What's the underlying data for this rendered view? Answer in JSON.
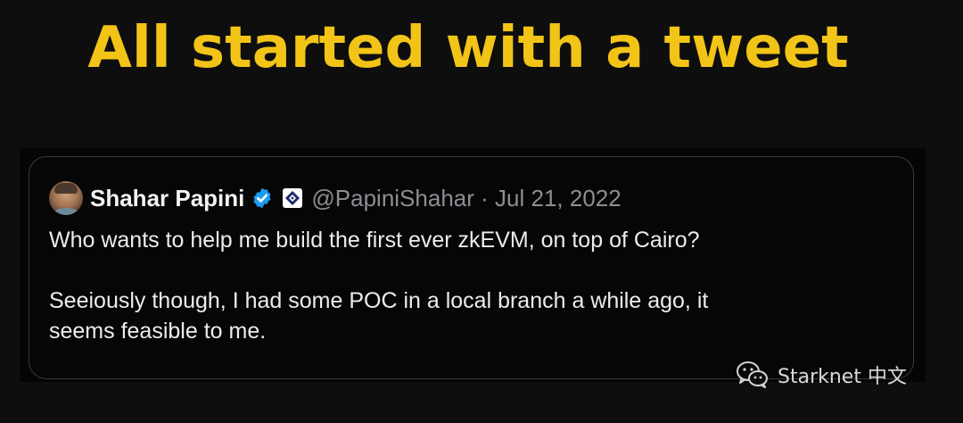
{
  "slide": {
    "title": "All started with a tweet"
  },
  "tweet": {
    "author_name": "Shahar Papini",
    "handle": "@PapiniShahar",
    "separator": "·",
    "date": "Jul 21, 2022",
    "paragraphs": [
      "Who wants to help me build the first ever zkEVM, on top of Cairo?",
      "Seeiously though, I had some POC in a local branch a while ago, it\nseems feasible to me."
    ],
    "icons": {
      "avatar": "avatar-photo",
      "verified": "verified-badge-icon",
      "affiliate": "affiliate-logo-icon"
    }
  },
  "watermark": {
    "label": "Starknet 中文",
    "icon": "wechat-icon"
  },
  "colors": {
    "title": "#f2c417",
    "background": "#0e0e0e",
    "verified_blue": "#1d9bf0",
    "handle_gray": "#8b8f94"
  }
}
